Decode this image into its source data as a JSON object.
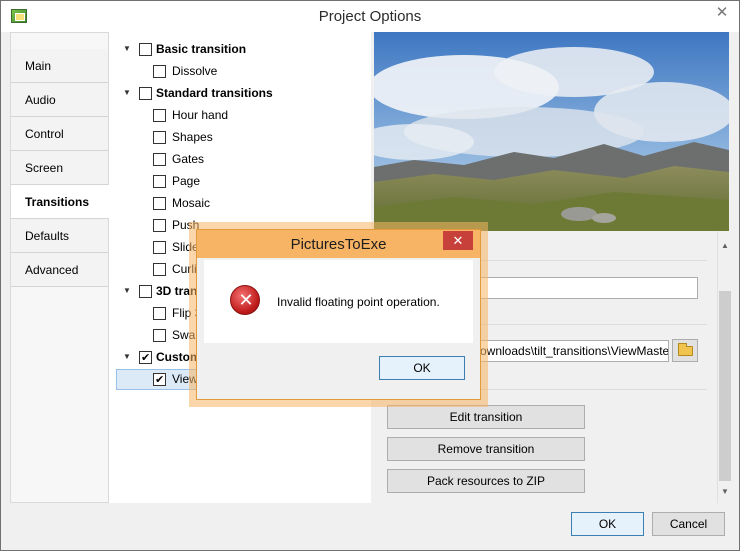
{
  "window": {
    "title": "Project Options"
  },
  "sidebar": {
    "tabs": [
      {
        "label": "Main"
      },
      {
        "label": "Audio"
      },
      {
        "label": "Control"
      },
      {
        "label": "Screen"
      },
      {
        "label": "Transitions",
        "active": true
      },
      {
        "label": "Defaults"
      },
      {
        "label": "Advanced"
      }
    ]
  },
  "tree": {
    "basic": {
      "label": "Basic transition",
      "items": [
        "Dissolve"
      ]
    },
    "standard": {
      "label": "Standard transitions",
      "items": [
        "Hour hand",
        "Shapes",
        "Gates",
        "Page",
        "Mosaic",
        "Push",
        "Slide",
        "Curli"
      ]
    },
    "three_d": {
      "label": "3D tran",
      "items": [
        "Flip 3",
        "Swap"
      ]
    },
    "custom": {
      "label": "Custom",
      "items": [
        "View"
      ]
    }
  },
  "right_panel": {
    "path_value": "ownloads\\tilt_transitions\\ViewMaste",
    "buttons": {
      "edit": "Edit transition",
      "remove": "Remove transition",
      "pack": "Pack resources to ZIP"
    }
  },
  "footer": {
    "ok": "OK",
    "cancel": "Cancel"
  },
  "dialog": {
    "title": "PicturesToExe",
    "message": "Invalid floating point operation.",
    "ok": "OK"
  },
  "icons": [
    "app-icon",
    "close-icon",
    "error-icon",
    "folder-icon",
    "scroll-up-icon",
    "scroll-down-icon"
  ]
}
